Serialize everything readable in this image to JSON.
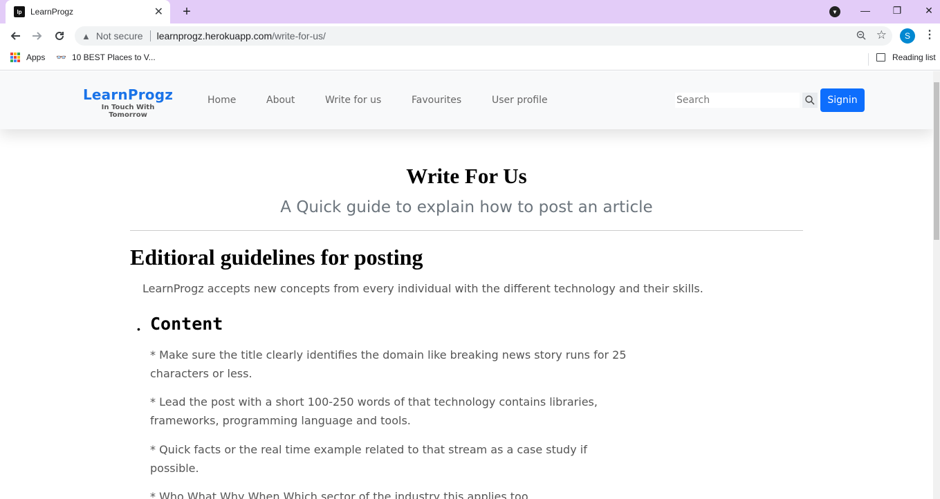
{
  "browser": {
    "tab_title": "LearnProgz",
    "favicon_text": "lp",
    "security_label": "Not secure",
    "url_host": "learnprogz.herokuapp.com",
    "url_path": "/write-for-us/",
    "account_initial": "S",
    "bookmarks": {
      "apps_label": "Apps",
      "item1_label": "10 BEST Places to V...",
      "reading_list_label": "Reading list"
    },
    "apps_colors": [
      "#ea4335",
      "#fbbc05",
      "#34a853",
      "#4285f4",
      "#ea4335",
      "#fbbc05",
      "#34a853",
      "#4285f4",
      "#ea4335"
    ]
  },
  "site": {
    "brand_name": "LearnProgz",
    "brand_tagline": "In Touch With Tomorrow",
    "nav": [
      "Home",
      "About",
      "Write for us",
      "Favourites",
      "User profile"
    ],
    "search_placeholder": "Search",
    "signin_label": "Signin",
    "accent_color": "#0d6efd"
  },
  "content": {
    "title": "Write For Us",
    "subtitle": "A Quick guide to explain how to post an article",
    "section_title": "Editioral guidelines for posting",
    "intro": "LearnProgz accepts new concepts from every individual with the different technology and their skills.",
    "content_heading": "Content",
    "guidelines": [
      "* Make sure the title clearly identifies the domain like breaking news story runs for 25 characters or less.",
      "* Lead the post with a short 100-250 words of that technology contains libraries, frameworks, programming language and tools.",
      "* Quick facts or the real time example related to that stream as a case study if possible.",
      "* Who What Why When Which sector of the industry this applies too"
    ]
  }
}
